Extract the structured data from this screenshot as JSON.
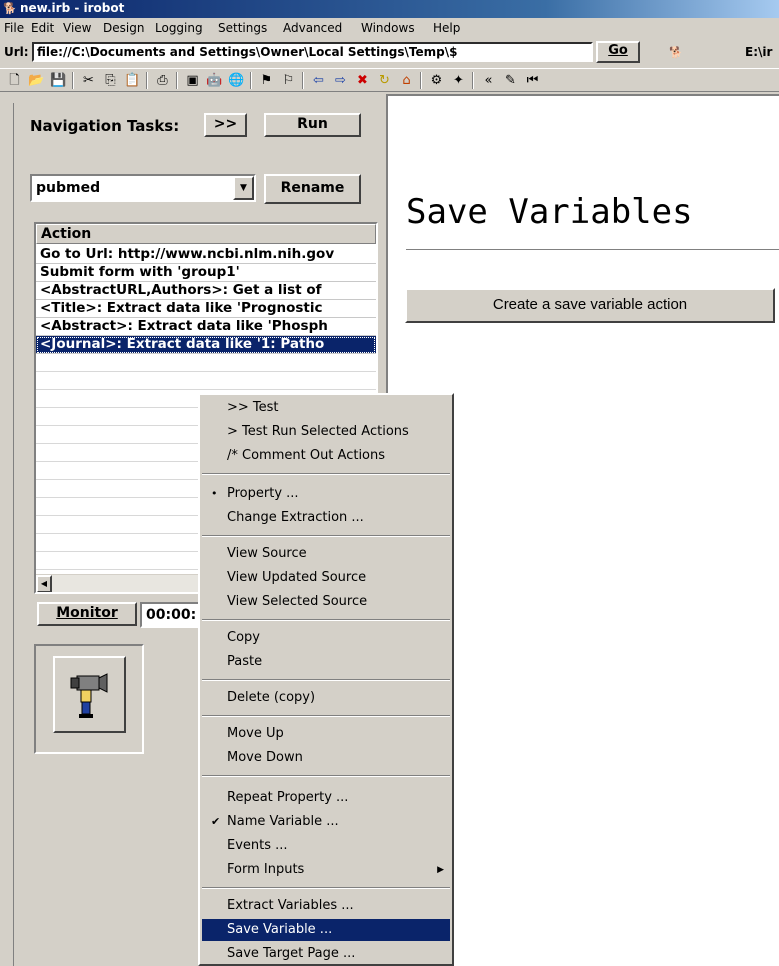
{
  "window": {
    "title": "new.irb - irobot",
    "app_icon": "dog-icon"
  },
  "menu": [
    "File",
    "Edit",
    "View",
    "Design",
    "Logging",
    "Settings",
    "Advanced",
    "Windows",
    "Help"
  ],
  "url_bar": {
    "label": "Url:",
    "value": "file://C:\\Documents and Settings\\Owner\\Local Settings\\Temp\\$",
    "go_label": "Go",
    "drive_label": "E:\\ir"
  },
  "nav": {
    "label": "Navigation Tasks:",
    "expand_label": ">>",
    "run_label": "Run",
    "task_value": "pubmed",
    "rename_label": "Rename"
  },
  "action_list": {
    "header": "Action",
    "rows": [
      "Go to Url: http://www.ncbi.nlm.nih.gov",
      "Submit form with 'group1'",
      "<AbstractURL,Authors>: Get a list of",
      "<Title>: Extract data like 'Prognostic",
      "<Abstract>: Extract data like 'Phosph",
      "<Journal>: Extract data like '1: Patho"
    ],
    "selected_index": 5
  },
  "monitor": {
    "label": "Monitor",
    "time": "00:00:"
  },
  "right_panel": {
    "title": "Save Variables",
    "create_button": "Create a save variable action"
  },
  "context_menu": {
    "items": [
      {
        "label": ">> Test"
      },
      {
        "label": "> Test Run Selected Actions"
      },
      {
        "label": "/* Comment Out Actions"
      },
      {
        "label": "Property ...",
        "mark": "•"
      },
      {
        "label": "Change Extraction ..."
      },
      {
        "label": "View Source"
      },
      {
        "label": "View Updated Source"
      },
      {
        "label": "View Selected Source"
      },
      {
        "label": "Copy"
      },
      {
        "label": "Paste"
      },
      {
        "label": "Delete (copy)"
      },
      {
        "label": "Move Up"
      },
      {
        "label": "Move Down"
      },
      {
        "label": "Repeat Property ..."
      },
      {
        "label": "Name Variable ...",
        "mark": "✔"
      },
      {
        "label": "Events ..."
      },
      {
        "label": "Form Inputs",
        "submenu": true
      },
      {
        "label": "Extract Variables ..."
      },
      {
        "label": "Save Variable ...",
        "highlighted": true
      },
      {
        "label": "Save Target Page ..."
      }
    ]
  },
  "colors": {
    "selection": "#0a246a",
    "face": "#d4d0c8",
    "titlebar": "#0a246a"
  }
}
